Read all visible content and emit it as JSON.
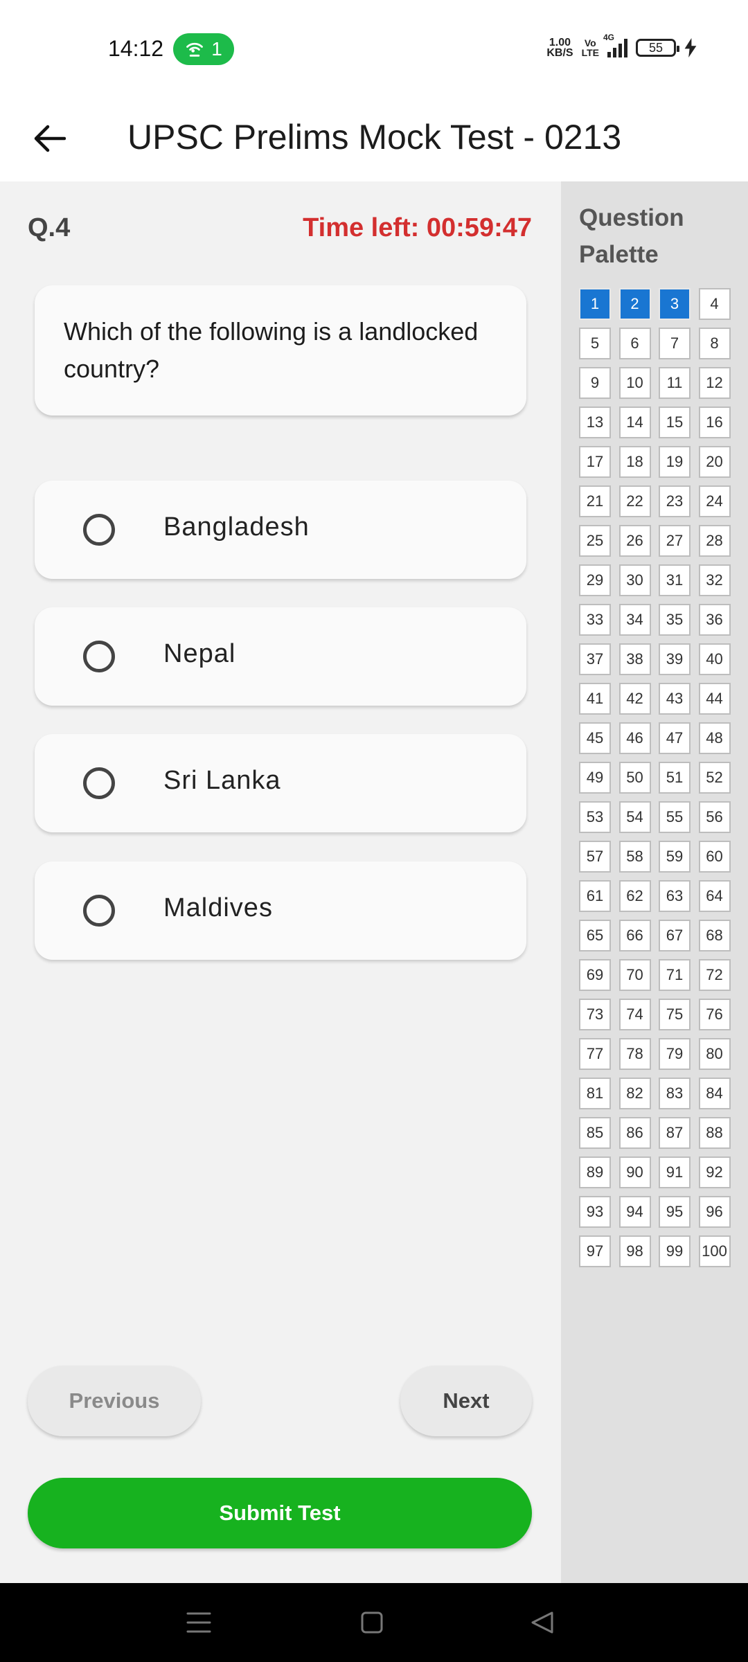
{
  "status_bar": {
    "time": "14:12",
    "hotspot_count": "1",
    "network_speed_value": "1.00",
    "network_speed_unit": "KB/S",
    "volte_top": "Vo",
    "volte_bottom": "LTE",
    "network_type": "4G",
    "battery_level": "55"
  },
  "app_bar": {
    "title": "UPSC Prelims Mock Test - 0213",
    "back_icon": "arrow-left-icon"
  },
  "question": {
    "number_label": "Q.4",
    "timer_label": "Time left: 00:59:47",
    "text": "Which of the following is a landlocked country?",
    "options": [
      "Bangladesh",
      "Nepal",
      "Sri Lanka",
      "Maldives"
    ]
  },
  "buttons": {
    "previous": "Previous",
    "next": "Next",
    "submit": "Submit Test"
  },
  "palette": {
    "title": "Question Palette",
    "total_questions": 100,
    "answered": [
      1,
      2,
      3
    ],
    "answered_color": "#1976d2"
  },
  "colors": {
    "timer": "#d32f2f",
    "submit": "#17b21f",
    "hotspot": "#1dbb4a"
  },
  "nav_bar": {
    "icons": [
      "menu-icon",
      "home-icon",
      "back-triangle-icon"
    ]
  }
}
